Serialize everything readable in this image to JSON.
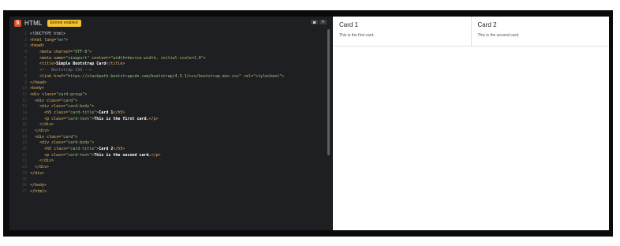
{
  "editor": {
    "language_label": "HTML",
    "badge": "Emmet enabled",
    "code_lines": [
      {
        "no": "1",
        "parts": [
          [
            "txt",
            "<!DOCTYPE html>"
          ]
        ]
      },
      {
        "no": "2",
        "parts": [
          [
            "tg",
            "<html "
          ],
          [
            "at",
            "lang="
          ],
          [
            "sv",
            "\"en\""
          ],
          [
            "tg",
            ">"
          ]
        ]
      },
      {
        "no": "3",
        "parts": [
          [
            "tg",
            "<head>"
          ]
        ]
      },
      {
        "no": "4",
        "parts": [
          [
            "txt",
            "    "
          ],
          [
            "tg",
            "<meta "
          ],
          [
            "at",
            "charset="
          ],
          [
            "sv",
            "\"UTF-8\""
          ],
          [
            "tg",
            ">"
          ]
        ]
      },
      {
        "no": "5",
        "parts": [
          [
            "txt",
            "    "
          ],
          [
            "tg",
            "<meta "
          ],
          [
            "at",
            "name="
          ],
          [
            "sv",
            "\"viewport\" "
          ],
          [
            "at",
            "content="
          ],
          [
            "sv",
            "\"width=device-width, initial-scale=1.0\""
          ],
          [
            "tg",
            ">"
          ]
        ]
      },
      {
        "no": "6",
        "parts": [
          [
            "txt",
            "    "
          ],
          [
            "tg",
            "<title>"
          ],
          [
            "bd",
            "Simple Bootstrap Card"
          ],
          [
            "tg",
            "</title>"
          ]
        ]
      },
      {
        "no": "7",
        "parts": [
          [
            "txt",
            "    "
          ],
          [
            "cm",
            "<!-- Bootstrap CSS -->"
          ]
        ]
      },
      {
        "no": "8",
        "parts": [
          [
            "txt",
            "    "
          ],
          [
            "tg",
            "<link "
          ],
          [
            "at",
            "href="
          ],
          [
            "sv",
            "\"https://stackpath.bootstrapcdn.com/bootstrap/4.3.1/css/bootstrap.min.css\" "
          ],
          [
            "at",
            "rel="
          ],
          [
            "sv",
            "\"stylesheet\""
          ],
          [
            "tg",
            ">"
          ]
        ]
      },
      {
        "no": "9",
        "parts": [
          [
            "tg",
            "</head>"
          ]
        ]
      },
      {
        "no": "10",
        "parts": [
          [
            "tg",
            "<body>"
          ]
        ]
      },
      {
        "no": "11",
        "parts": [
          [
            "tg",
            "<div "
          ],
          [
            "at",
            "class="
          ],
          [
            "sv",
            "\"card-group\""
          ],
          [
            "tg",
            ">"
          ]
        ]
      },
      {
        "no": "12",
        "parts": [
          [
            "txt",
            "  "
          ],
          [
            "tg",
            "<div "
          ],
          [
            "at",
            "class="
          ],
          [
            "sv",
            "\"card\""
          ],
          [
            "tg",
            ">"
          ]
        ]
      },
      {
        "no": "13",
        "parts": [
          [
            "txt",
            "    "
          ],
          [
            "tg",
            "<div "
          ],
          [
            "at",
            "class="
          ],
          [
            "sv",
            "\"card-body\""
          ],
          [
            "tg",
            ">"
          ]
        ]
      },
      {
        "no": "14",
        "parts": [
          [
            "txt",
            "      "
          ],
          [
            "tg",
            "<h5 "
          ],
          [
            "at",
            "class="
          ],
          [
            "sv",
            "\"card-title\""
          ],
          [
            "tg",
            ">"
          ],
          [
            "bd",
            "Card 1"
          ],
          [
            "tg",
            "</h5>"
          ]
        ]
      },
      {
        "no": "15",
        "parts": [
          [
            "txt",
            "      "
          ],
          [
            "tg",
            "<p "
          ],
          [
            "at",
            "class="
          ],
          [
            "sv",
            "\"card-text\""
          ],
          [
            "tg",
            ">"
          ],
          [
            "bd",
            "This is the first card."
          ],
          [
            "tg",
            "</p>"
          ]
        ]
      },
      {
        "no": "16",
        "parts": [
          [
            "txt",
            "    "
          ],
          [
            "tg",
            "</div>"
          ]
        ]
      },
      {
        "no": "17",
        "parts": [
          [
            "txt",
            "  "
          ],
          [
            "tg",
            "</div>"
          ]
        ]
      },
      {
        "no": "18",
        "parts": [
          [
            "txt",
            "  "
          ],
          [
            "tg",
            "<div "
          ],
          [
            "at",
            "class="
          ],
          [
            "sv",
            "\"card\""
          ],
          [
            "tg",
            ">"
          ]
        ]
      },
      {
        "no": "19",
        "parts": [
          [
            "txt",
            "    "
          ],
          [
            "tg",
            "<div "
          ],
          [
            "at",
            "class="
          ],
          [
            "sv",
            "\"card-body\""
          ],
          [
            "tg",
            ">"
          ]
        ]
      },
      {
        "no": "20",
        "parts": [
          [
            "txt",
            "      "
          ],
          [
            "tg",
            "<h5 "
          ],
          [
            "at",
            "class="
          ],
          [
            "sv",
            "\"card-title\""
          ],
          [
            "tg",
            ">"
          ],
          [
            "bd",
            "Card 2"
          ],
          [
            "tg",
            "</h5>"
          ]
        ]
      },
      {
        "no": "21",
        "parts": [
          [
            "txt",
            "      "
          ],
          [
            "tg",
            "<p "
          ],
          [
            "at",
            "class="
          ],
          [
            "sv",
            "\"card-text\""
          ],
          [
            "tg",
            ">"
          ],
          [
            "bd",
            "This is the second card."
          ],
          [
            "tg",
            "</p>"
          ]
        ]
      },
      {
        "no": "22",
        "parts": [
          [
            "txt",
            "    "
          ],
          [
            "tg",
            "</div>"
          ]
        ]
      },
      {
        "no": "23",
        "parts": [
          [
            "txt",
            "  "
          ],
          [
            "tg",
            "</div>"
          ]
        ]
      },
      {
        "no": "24",
        "parts": [
          [
            "tg",
            "</div>"
          ]
        ]
      },
      {
        "no": "25",
        "parts": []
      },
      {
        "no": "26",
        "parts": [
          [
            "tg",
            "</body>"
          ]
        ]
      },
      {
        "no": "27",
        "parts": [
          [
            "tg",
            "</html>"
          ]
        ]
      }
    ],
    "colors": {
      "background": "#1e1f22",
      "tag": "#e5b45f",
      "string": "#98c379",
      "comment": "#7f848e",
      "badge": "#f2c230"
    }
  },
  "preview": {
    "cards": [
      {
        "title": "Card 1",
        "text": "This is the first card."
      },
      {
        "title": "Card 2",
        "text": "This is the second card."
      }
    ]
  }
}
